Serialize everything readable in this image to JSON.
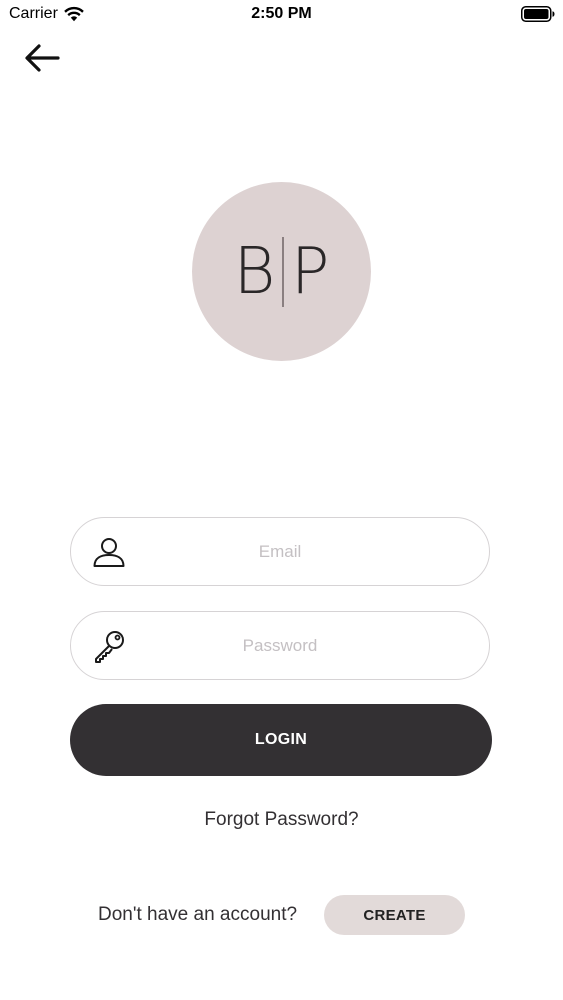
{
  "status_bar": {
    "carrier": "Carrier",
    "time": "2:50 PM",
    "wifi_icon": "wifi-icon",
    "battery_icon": "battery-icon"
  },
  "nav": {
    "back_icon": "arrow-left-icon"
  },
  "logo": {
    "left_letter": "B",
    "right_letter": "P",
    "background_color": "#ddd2d2"
  },
  "form": {
    "email": {
      "placeholder": "Email",
      "value": "",
      "icon": "user-icon"
    },
    "password": {
      "placeholder": "Password",
      "value": "",
      "icon": "key-icon"
    },
    "login_label": "LOGIN",
    "login_color": "#333033",
    "forgot_label": "Forgot Password?"
  },
  "footer": {
    "prompt": "Don't have an account?",
    "create_label": "CREATE",
    "create_color": "#e2dad9"
  }
}
